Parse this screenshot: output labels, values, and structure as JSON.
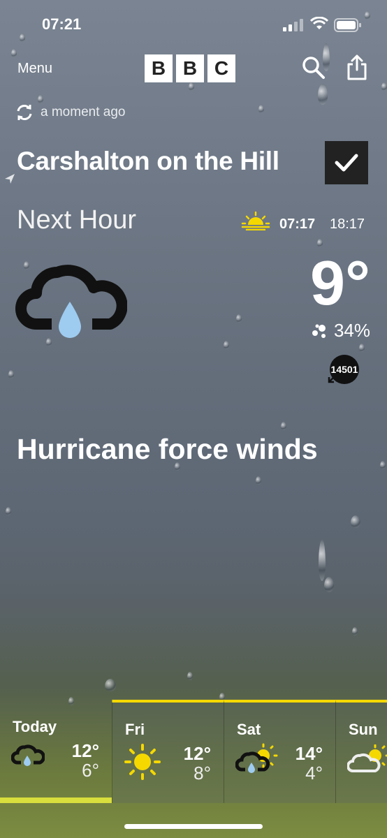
{
  "status_bar": {
    "time": "07:21"
  },
  "header": {
    "menu_label": "Menu",
    "logo": [
      "B",
      "B",
      "C"
    ]
  },
  "refresh": {
    "updated_text": "a moment ago"
  },
  "location": {
    "name": "Carshalton on the Hill"
  },
  "now": {
    "period_label": "Next Hour",
    "sunrise": "07:17",
    "sunset": "18:17",
    "temperature": "9°",
    "humidity": "34%",
    "wind_speed": "14501",
    "description": "Hurricane force winds"
  },
  "forecast": [
    {
      "day": "Today",
      "high": "12°",
      "low": "6°",
      "icon": "cloud-rain-icon"
    },
    {
      "day": "Fri",
      "high": "12°",
      "low": "8°",
      "icon": "sun-icon"
    },
    {
      "day": "Sat",
      "high": "14°",
      "low": "4°",
      "icon": "sun-cloud-rain-icon"
    },
    {
      "day": "Sun",
      "high": "",
      "low": "",
      "icon": "sun-cloud-icon"
    }
  ],
  "colors": {
    "accent_yellow": "#F5D800",
    "today_bar": "#D9DF3C",
    "rain_drop": "#9ECBF0"
  }
}
